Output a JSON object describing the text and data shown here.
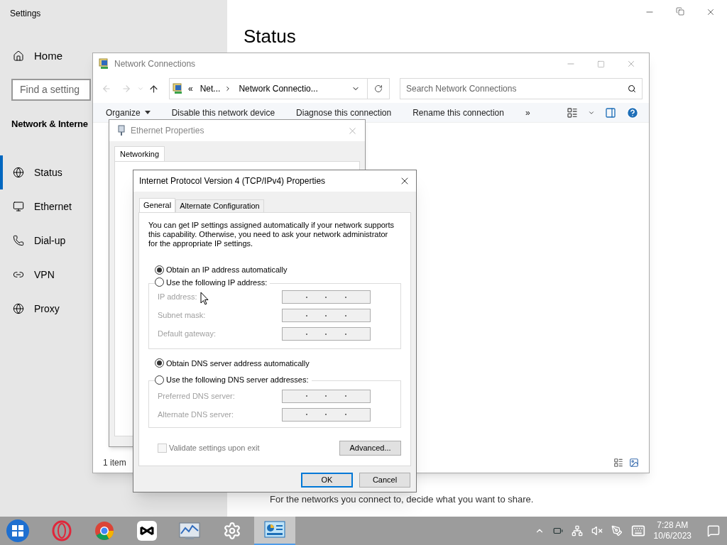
{
  "settings": {
    "title": "Settings",
    "home": "Home",
    "search": {
      "placeholder": "Find a setting"
    },
    "section": "Network & Interne",
    "page_title": "Status",
    "footer_text": "For the networks you connect to, decide what you want to share.",
    "nav": [
      {
        "label": "Status",
        "kind": "status",
        "selected": true
      },
      {
        "label": "Ethernet",
        "kind": "ethernet",
        "selected": false
      },
      {
        "label": "Dial-up",
        "kind": "dialup",
        "selected": false
      },
      {
        "label": "VPN",
        "kind": "vpn",
        "selected": false
      },
      {
        "label": "Proxy",
        "kind": "proxy",
        "selected": false
      }
    ]
  },
  "network_connections": {
    "title": "Network Connections",
    "breadcrumb_prefix": "«",
    "breadcrumb": [
      "Net...",
      "Network Connectio..."
    ],
    "search": {
      "placeholder": "Search Network Connections"
    },
    "toolbar": [
      {
        "label": "Organize",
        "dropdown": true
      },
      {
        "label": "Disable this network device",
        "dropdown": false
      },
      {
        "label": "Diagnose this connection",
        "dropdown": false
      },
      {
        "label": "Rename this connection",
        "dropdown": false
      }
    ],
    "more": "»",
    "status_bar": "1 item"
  },
  "ethernet_properties": {
    "title": "Ethernet Properties",
    "tabs": [
      {
        "label": "Networking",
        "selected": true
      }
    ]
  },
  "ipv4_properties": {
    "title": "Internet Protocol Version 4 (TCP/IPv4) Properties",
    "tabs": [
      {
        "label": "General",
        "selected": true
      },
      {
        "label": "Alternate Configuration",
        "selected": false
      }
    ],
    "description": "You can get IP settings assigned automatically if your network supports this capability. Otherwise, you need to ask your network administrator for the appropriate IP settings.",
    "ip_options": [
      {
        "label": "Obtain an IP address automatically",
        "selected": true
      },
      {
        "label": "Use the following IP address:",
        "selected": false
      }
    ],
    "ip_fields": [
      {
        "label": "IP address:",
        "disabled": true
      },
      {
        "label": "Subnet mask:",
        "disabled": true
      },
      {
        "label": "Default gateway:",
        "disabled": true
      }
    ],
    "dns_options": [
      {
        "label": "Obtain DNS server address automatically",
        "selected": true
      },
      {
        "label": "Use the following DNS server addresses:",
        "selected": false
      }
    ],
    "dns_fields": [
      {
        "label": "Preferred DNS server:",
        "disabled": true
      },
      {
        "label": "Alternate DNS server:",
        "disabled": true
      }
    ],
    "validate": {
      "label": "Validate settings upon exit",
      "checked": false,
      "disabled": true
    },
    "advanced": "Advanced...",
    "ok": "OK",
    "cancel": "Cancel"
  },
  "taskbar": {
    "apps": [
      {
        "kind": "opera",
        "selected": false
      },
      {
        "kind": "chrome",
        "selected": false
      },
      {
        "kind": "capcut",
        "selected": false
      },
      {
        "kind": "monitor",
        "selected": false
      },
      {
        "kind": "settings",
        "selected": false
      },
      {
        "kind": "control-panel",
        "selected": true
      }
    ],
    "time": "7:28 AM",
    "date": "10/6/2023"
  }
}
